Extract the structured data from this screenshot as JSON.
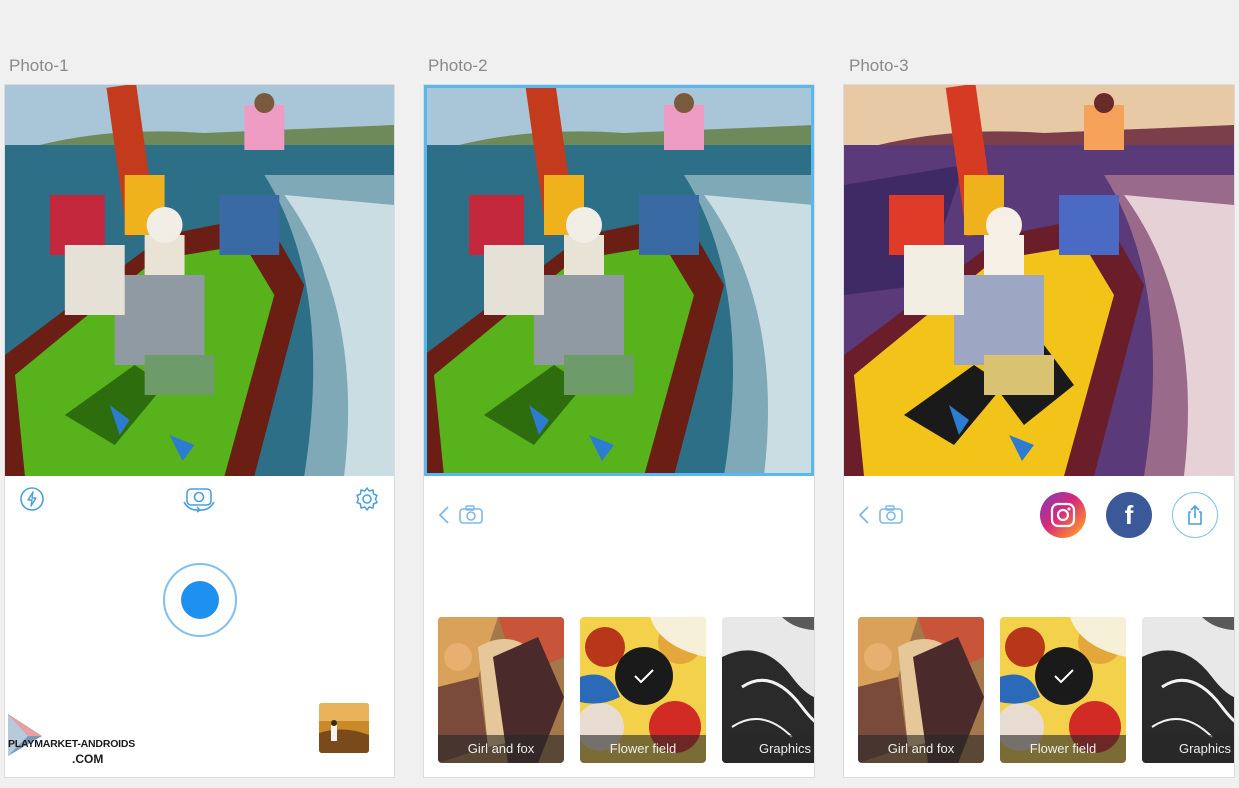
{
  "panels": [
    {
      "label": "Photo-1"
    },
    {
      "label": "Photo-2"
    },
    {
      "label": "Photo-3"
    }
  ],
  "camera_screen": {
    "top_icons": [
      "flash-icon",
      "switch-camera-icon",
      "settings-icon"
    ],
    "shutter": "capture-button"
  },
  "filters": {
    "items": [
      {
        "name": "Girl and fox"
      },
      {
        "name": "Flower field",
        "selected": true
      },
      {
        "name": "Graphics"
      }
    ]
  },
  "share": {
    "targets": [
      "instagram-icon",
      "facebook-icon",
      "share-icon"
    ],
    "facebook_glyph": "f"
  },
  "watermark": {
    "line1": "PLAYMARKET-ANDROIDS",
    "line2": ".COM"
  },
  "colors": {
    "accent": "#1e90f0",
    "selection_border": "#5bb8ee",
    "facebook": "#3b5998"
  }
}
